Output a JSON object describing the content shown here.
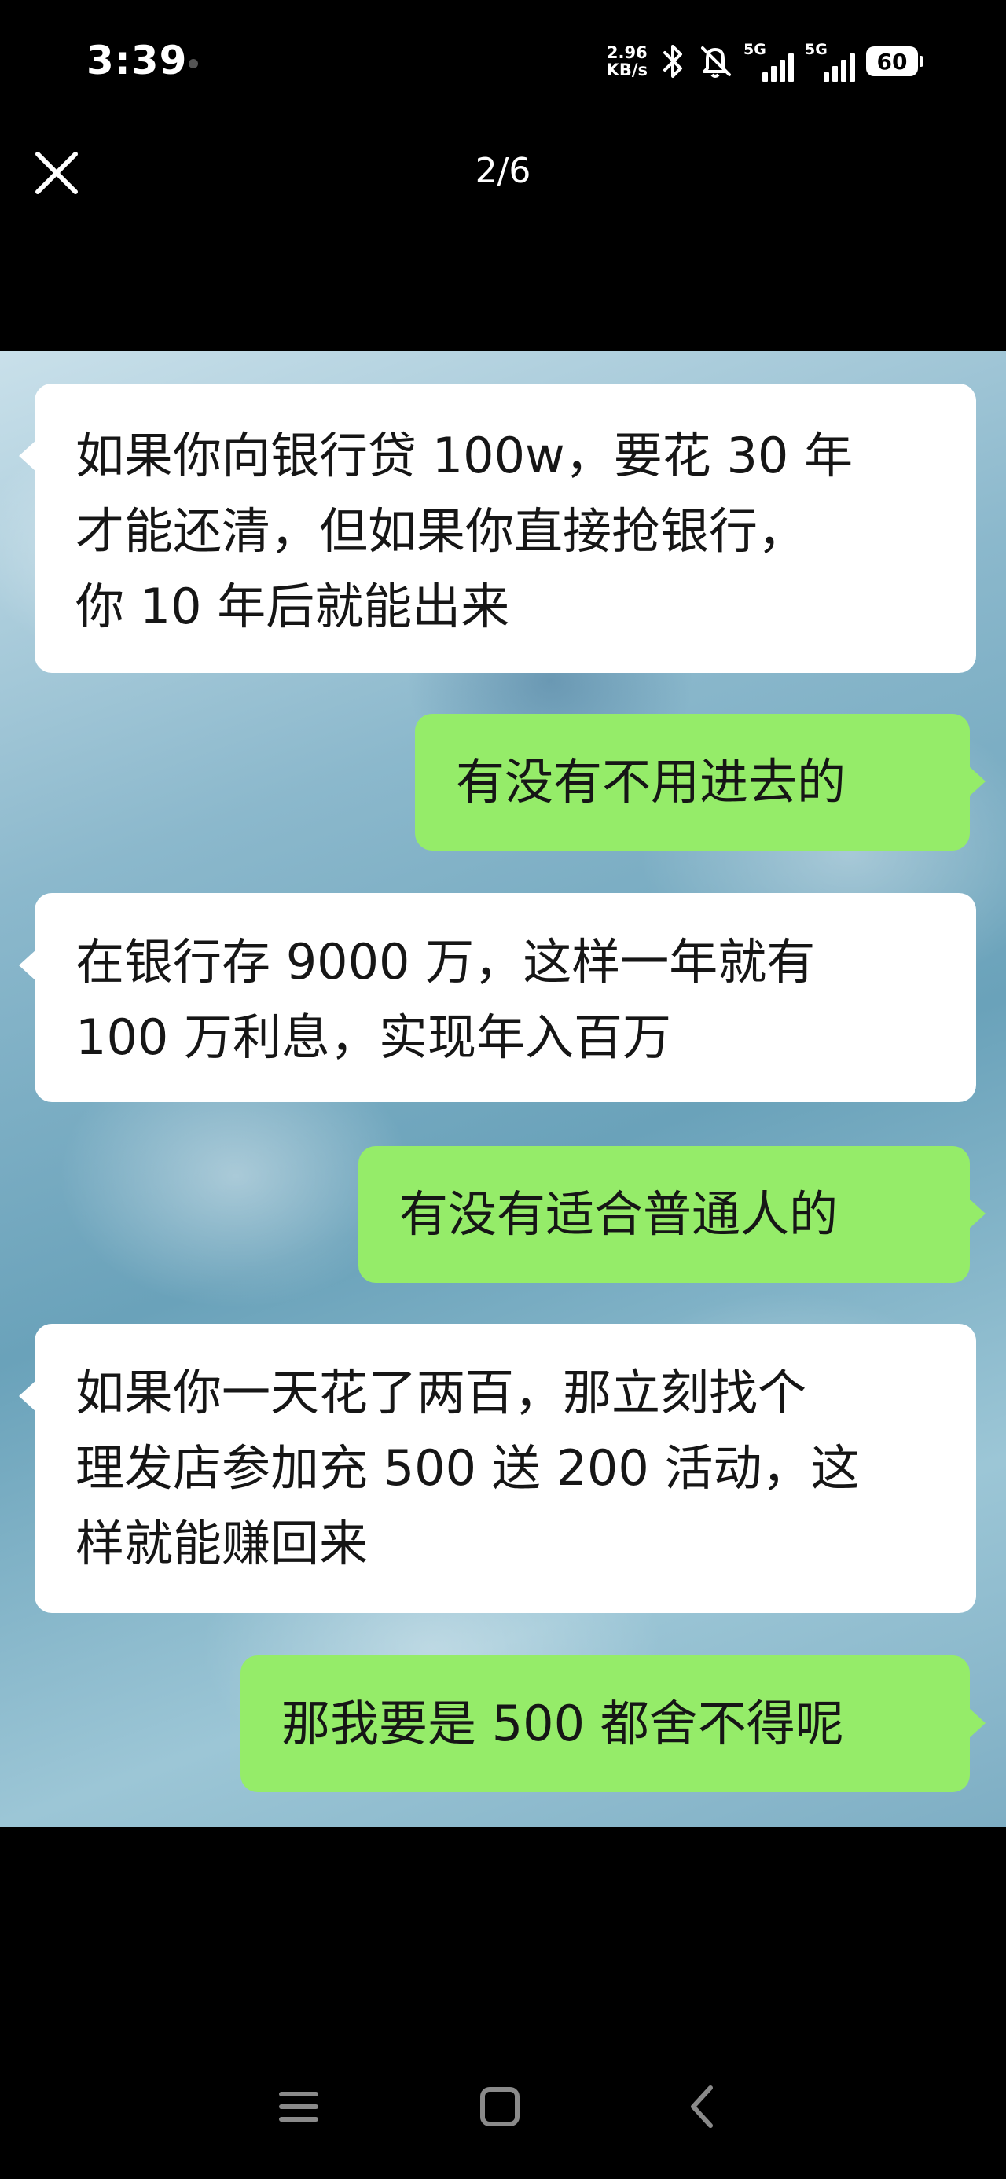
{
  "status_bar": {
    "time": "3:39",
    "network_speed_value": "2.96",
    "network_speed_unit": "KB/s",
    "sim1_label": "5G",
    "sim2_label": "5G",
    "battery": "60",
    "icons": [
      "bluetooth-icon",
      "mute-icon",
      "signal-icon",
      "battery-icon"
    ]
  },
  "viewer": {
    "page_counter": "2/6",
    "close_icon": "close-icon"
  },
  "colors": {
    "incoming_bubble": "#ffffff",
    "outgoing_bubble": "#95ec69",
    "text": "#161616",
    "background": "#000000"
  },
  "messages": [
    {
      "side": "incoming",
      "lines": [
        "如果你向银行贷 100w，要花 30 年",
        "才能还清，但如果你直接抢银行，",
        "你 10 年后就能出来"
      ]
    },
    {
      "side": "outgoing",
      "lines": [
        "有没有不用进去的"
      ]
    },
    {
      "side": "incoming",
      "lines": [
        "在银行存 9000 万，这样一年就有",
        "100 万利息，实现年入百万"
      ]
    },
    {
      "side": "outgoing",
      "lines": [
        "有没有适合普通人的"
      ]
    },
    {
      "side": "incoming",
      "lines": [
        "如果你一天花了两百，那立刻找个",
        "理发店参加充 500 送 200 活动，这",
        "样就能赚回来"
      ]
    },
    {
      "side": "outgoing",
      "lines": [
        "那我要是 500 都舍不得呢"
      ]
    }
  ],
  "nav_bar": {
    "icons": [
      "menu-icon",
      "home-icon",
      "back-icon"
    ]
  }
}
